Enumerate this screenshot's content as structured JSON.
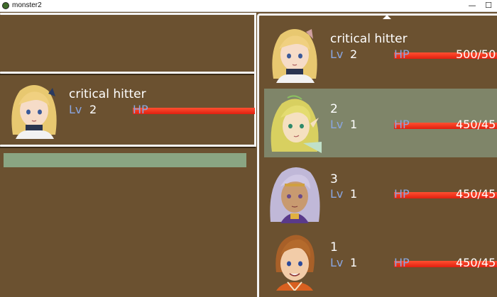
{
  "window": {
    "title": "monster2",
    "minimize_glyph": "—",
    "maximize_glyph": "☐"
  },
  "colors": {
    "background": "#6b5130",
    "hp_bar": "#ee3322",
    "lv_label": "#8aa6e0",
    "selection": "#7f8569",
    "input_bar": "#8aa582"
  },
  "status_panel": {
    "name": "critical hitter",
    "lv_label": "Lv",
    "lv": "2",
    "hp_label": "HP"
  },
  "party_list": [
    {
      "name": "critical hitter",
      "lv_label": "Lv",
      "lv": "2",
      "hp_label": "HP",
      "hp_text": "500/50",
      "selected": false
    },
    {
      "name": "2",
      "lv_label": "Lv",
      "lv": "1",
      "hp_label": "HP",
      "hp_text": "450/45",
      "selected": true
    },
    {
      "name": "3",
      "lv_label": "Lv",
      "lv": "1",
      "hp_label": "HP",
      "hp_text": "450/45",
      "selected": false
    },
    {
      "name": "1",
      "lv_label": "Lv",
      "lv": "1",
      "hp_label": "HP",
      "hp_text": "450/45",
      "selected": false
    }
  ]
}
